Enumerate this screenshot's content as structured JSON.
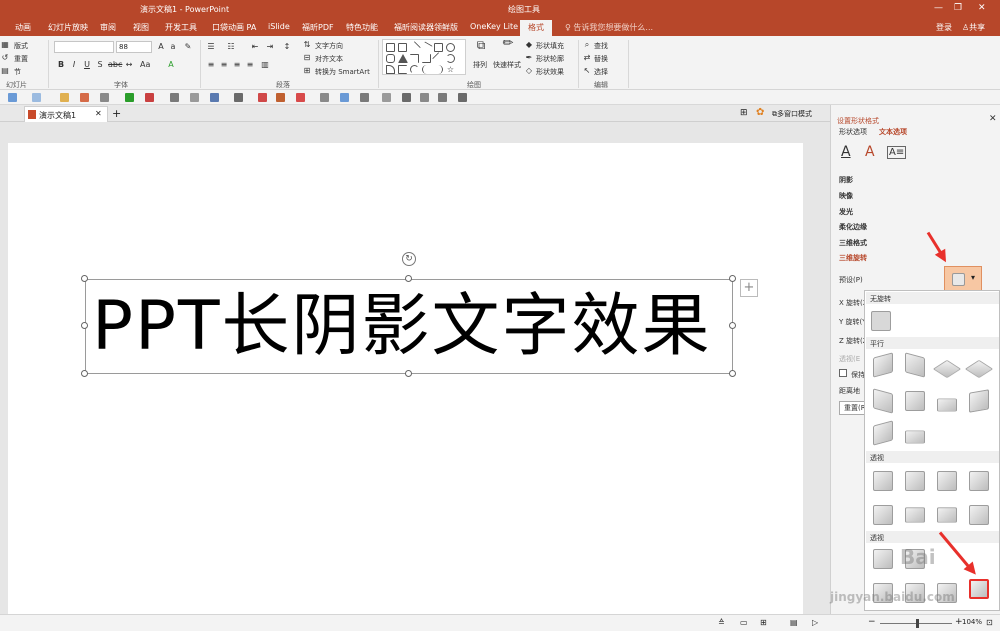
{
  "window": {
    "title": "演示文稿1 - PowerPoint",
    "context_tab_group": "绘图工具",
    "minimize": "—",
    "restore": "❐",
    "close": "✕"
  },
  "tabs": [
    "动画",
    "幻灯片放映",
    "审阅",
    "视图",
    "开发工具",
    "口袋动画 PA",
    "iSlide",
    "福昕PDF",
    "特色功能",
    "福昕阅读器领鲜版",
    "OneKey Lite",
    "格式"
  ],
  "tell_me": "告诉我您想要做什么...",
  "signin": "登录",
  "share": "共享",
  "ribbon": {
    "slides": {
      "layout": "版式",
      "reset": "重置",
      "section": "节",
      "group": "幻灯片"
    },
    "font": {
      "size": "88",
      "group": "字体"
    },
    "paragraph": {
      "text_direction": "文字方向",
      "align_text": "对齐文本",
      "convert_smartart": "转换为 SmartArt",
      "group": "段落"
    },
    "drawing": {
      "arrange": "排列",
      "quick_styles": "快速样式",
      "shape_fill": "形状填充",
      "shape_outline": "形状轮廓",
      "shape_effects": "形状效果",
      "group": "绘图"
    },
    "editing": {
      "find": "查找",
      "replace": "替换",
      "select": "选择",
      "group": "编辑"
    }
  },
  "doc_tab": "演示文稿1",
  "multi_window": "多窗口模式",
  "slide_text": "PPT长阴影文字效果",
  "pane": {
    "title": "设置形状格式",
    "tab_shape": "形状选项",
    "tab_text": "文本选项",
    "sections": [
      "阴影",
      "映像",
      "发光",
      "柔化边缘",
      "三维格式",
      "三维旋转"
    ],
    "preset_label": "预设(P)",
    "x_rot": "X 旋转(X",
    "y_rot": "Y 旋转(Y",
    "z_rot": "Z 旋转(Z",
    "perspective": "透视(E",
    "keep_text_flat": "保持",
    "distance": "距离地",
    "reset": "重置(R"
  },
  "gallery": {
    "no_rotation": "无旋转",
    "parallel": "平行",
    "perspective1": "透视",
    "perspective2": "透视"
  },
  "status": {
    "zoom": "104%"
  },
  "watermark": {
    "line1": "Bai",
    "line2": "jingyan.baidu.com"
  },
  "colors": {
    "accent": "#b7472a",
    "arrow": "#e8302b",
    "preset_highlight": "#f7c7a3"
  }
}
